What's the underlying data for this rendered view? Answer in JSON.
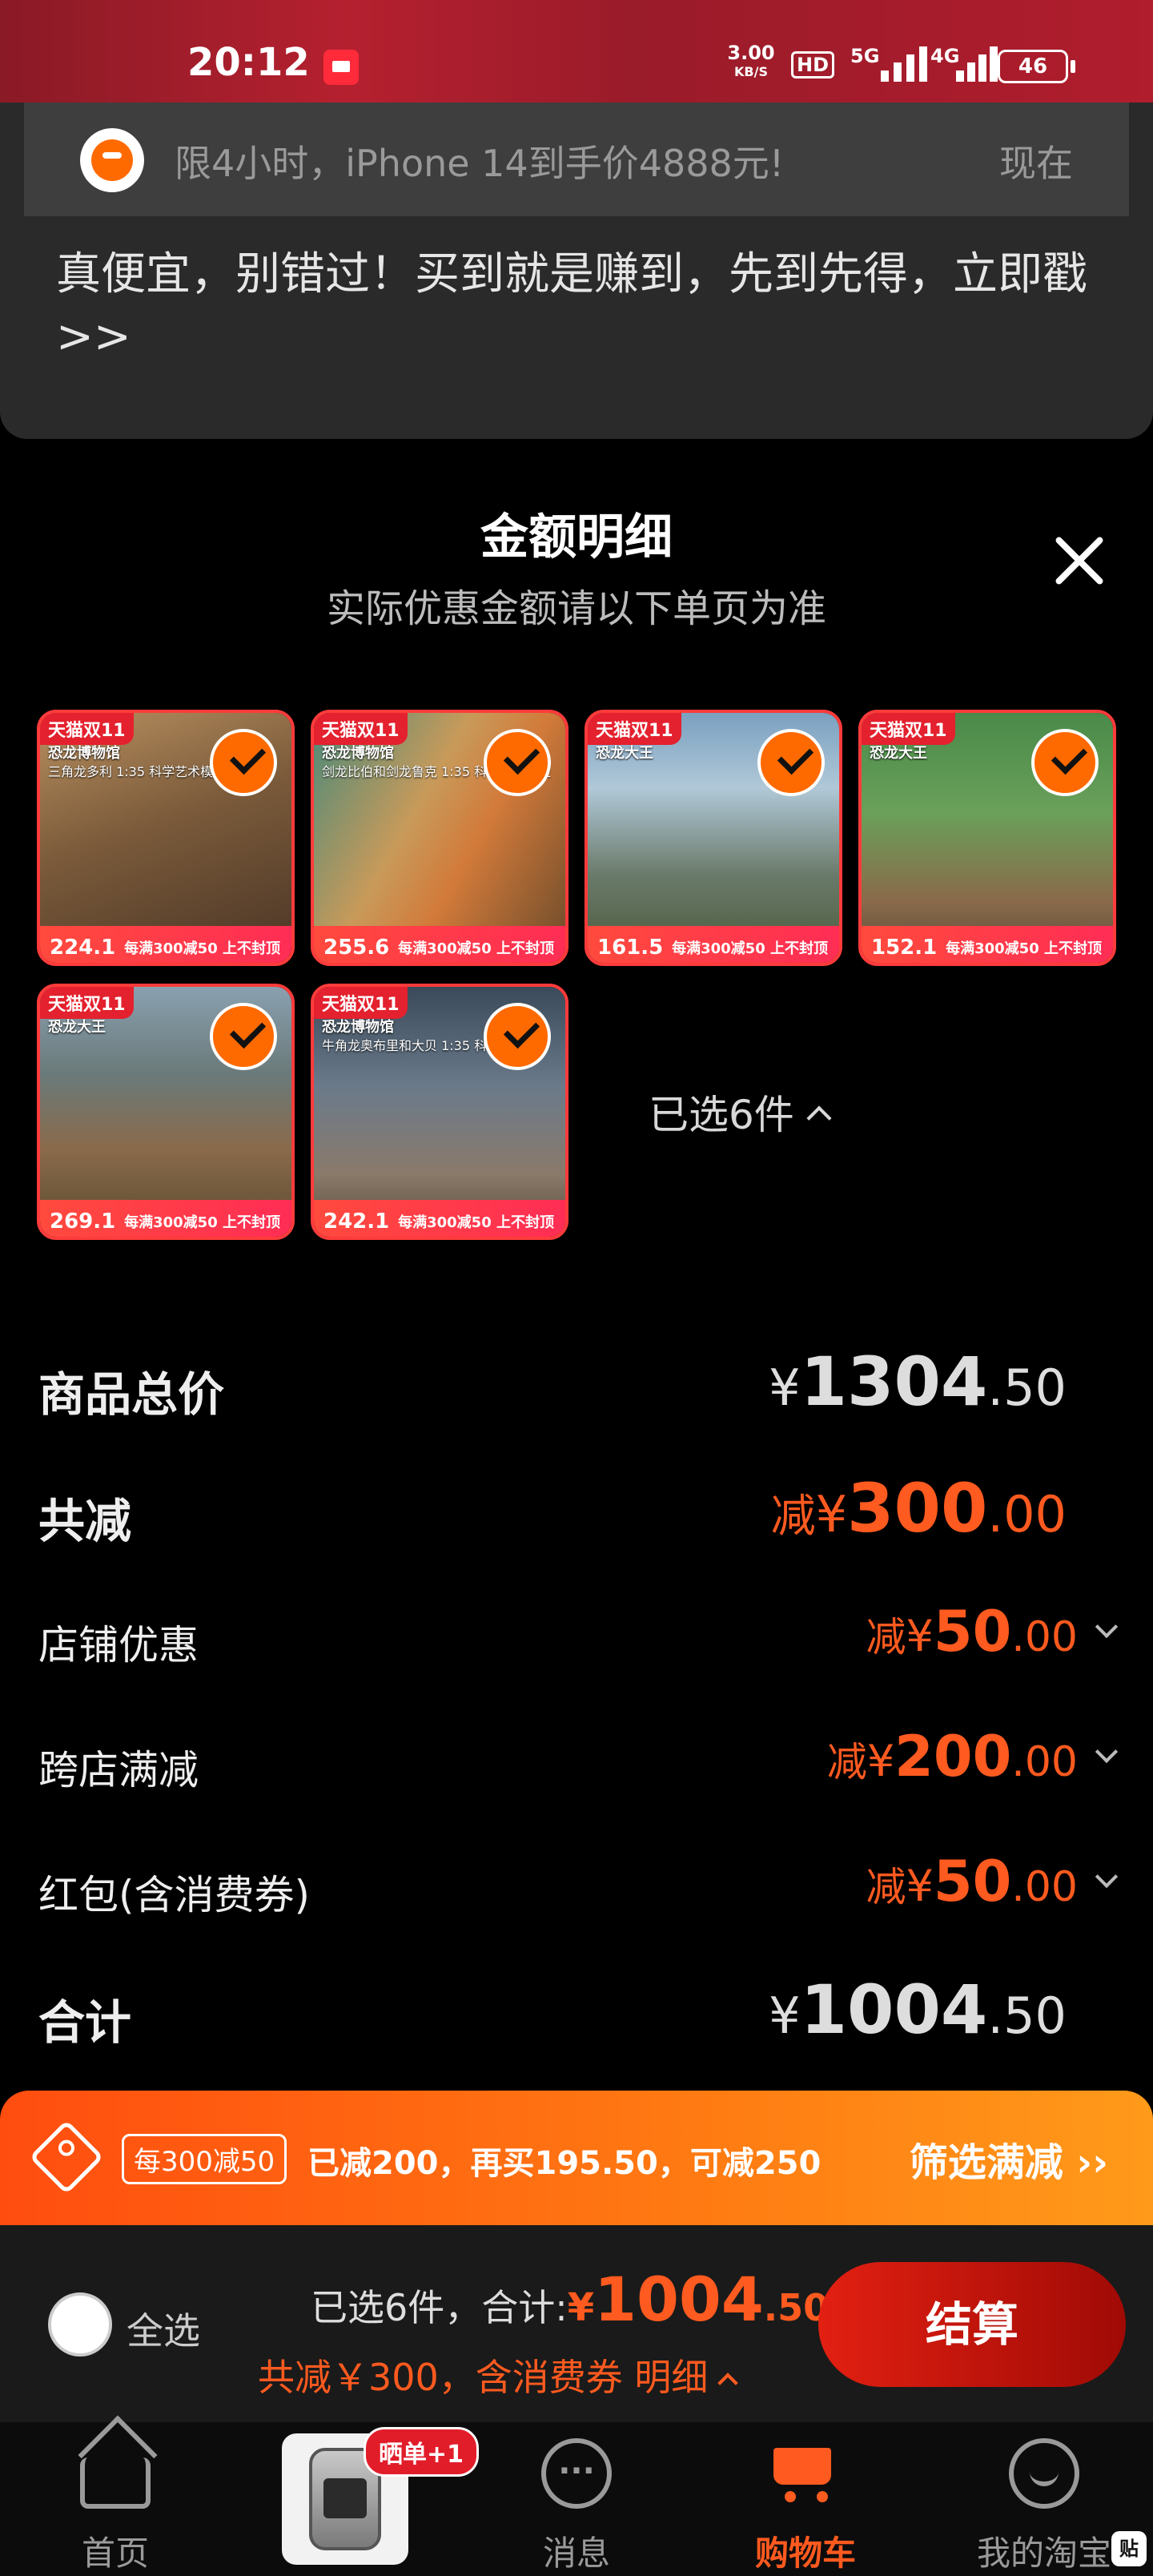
{
  "status_bar": {
    "time": "20:12",
    "net_speed_value": "3.00",
    "net_speed_unit": "KB/S",
    "hd": "HD",
    "sig1": "5G",
    "sig2": "4G",
    "battery": "46"
  },
  "notification": {
    "headline": "限4小时，iPhone 14到手价4888元!",
    "time": "现在",
    "body": "真便宜，别错过！买到就是赚到，先到先得，立即戳>>"
  },
  "sheet": {
    "title": "金额明细",
    "subtitle": "实际优惠金额请以下单页为准",
    "items": [
      {
        "brand": "天猫双11",
        "line1": "恐龙博物馆",
        "line2": "三角龙多利 1:35 科学艺术模型",
        "price": "224.1",
        "promo": "每满300减50 上不封顶"
      },
      {
        "brand": "天猫双11",
        "line1": "恐龙博物馆",
        "line2": "剑龙比伯和剑龙鲁克 1:35 科学艺术模型",
        "price": "255.6",
        "promo": "每满300减50 上不封顶"
      },
      {
        "brand": "天猫双11",
        "line1": "恐龙大王",
        "line2": "",
        "price": "161.5",
        "promo": "每满300减50 上不封顶"
      },
      {
        "brand": "天猫双11",
        "line1": "恐龙大王",
        "line2": "",
        "price": "152.1",
        "promo": "每满300减50 上不封顶"
      },
      {
        "brand": "天猫双11",
        "line1": "恐龙大王",
        "line2": "",
        "price": "269.1",
        "promo": "每满300减50 上不封顶"
      },
      {
        "brand": "天猫双11",
        "line1": "恐龙博物馆",
        "line2": "牛角龙奥布里和大贝 1:35 科学",
        "price": "242.1",
        "promo": "每满300减50 上不封顶"
      }
    ],
    "selected_count": "已选6件",
    "rows": {
      "total_label": "商品总价",
      "total_yen": "¥",
      "total_int": "1304",
      "total_dec": ".50",
      "reduce_label": "共减",
      "reduce_prefix": "减",
      "reduce_yen": "¥",
      "reduce_int": "300",
      "reduce_dec": ".00",
      "store_label": "店铺优惠",
      "store_prefix": "减",
      "store_yen": "¥",
      "store_int": "50",
      "store_dec": ".00",
      "cross_label": "跨店满减",
      "cross_prefix": "减",
      "cross_yen": "¥",
      "cross_int": "200",
      "cross_dec": ".00",
      "redpacket_label": "红包(含消费券)",
      "redpacket_prefix": "减",
      "redpacket_yen": "¥",
      "redpacket_int": "50",
      "redpacket_dec": ".00",
      "sum_label": "合计",
      "sum_yen": "¥",
      "sum_int": "1004",
      "sum_dec": ".50"
    }
  },
  "promo_banner": {
    "pill": "每300减50",
    "message": "已减200，再买195.50，可减250",
    "filter": "筛选满减 ››"
  },
  "checkout": {
    "select_all": "全选",
    "summary_prefix": "已选6件，合计:",
    "total_yen": "¥",
    "total_int": "1004",
    "total_dec": ".50",
    "sub": "共减￥300，含消费券 明细",
    "pay": "结算"
  },
  "tabbar": {
    "home": "首页",
    "badge": "晒单+1",
    "messages": "消息",
    "cart": "购物车",
    "me": "我的淘宝"
  },
  "colors": {
    "accent": "#ff5a1f",
    "status_bar": "#b5202f",
    "pay_button": "#d11a10"
  }
}
